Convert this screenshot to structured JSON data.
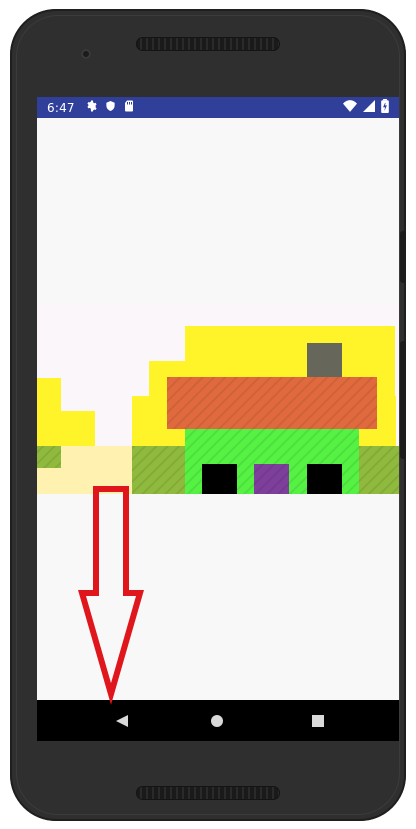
{
  "status_bar": {
    "time": "6:47"
  },
  "icons": {
    "settings": "gear-icon",
    "shield": "shield-icon",
    "sd_card": "sd-card-icon",
    "wifi": "wifi-icon",
    "signal": "signal-icon",
    "battery": "battery-icon",
    "back": "back-icon",
    "home": "home-icon",
    "recents": "recents-icon"
  },
  "colors": {
    "status_bar": "#2f3f9a",
    "yellow": "#fff42a",
    "orange_roof": "#e06a3e",
    "green_house": "#55f244",
    "olive_ground": "#8fba3d",
    "pale_ground": "#fff2b1",
    "chimney_gray": "#66665a",
    "door_purple": "#7d3f9b",
    "annotation_red": "#e0161d"
  }
}
